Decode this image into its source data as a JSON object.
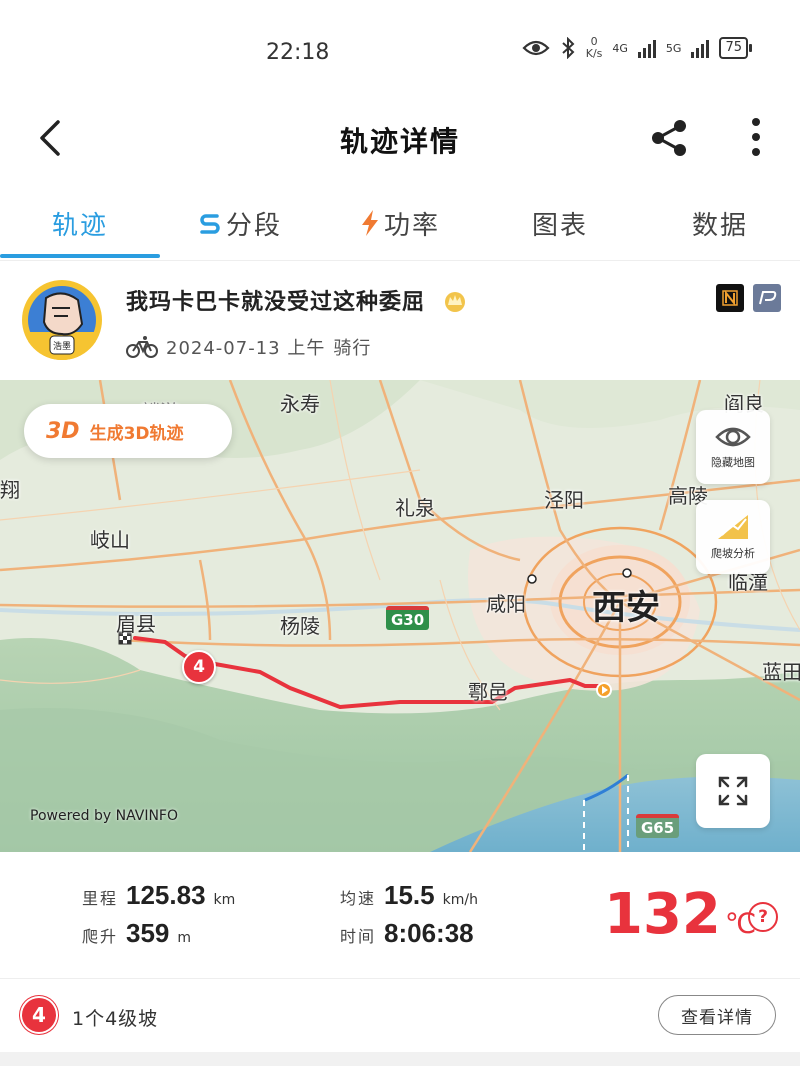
{
  "status": {
    "time": "22:18",
    "net_speed_value": "0",
    "net_speed_unit": "K/s",
    "sim1": "4G",
    "sim2": "5G",
    "battery": "75"
  },
  "header": {
    "title": "轨迹详情",
    "back_icon": "chevron-left-icon",
    "share_icon": "share-icon",
    "more_icon": "more-vertical-icon"
  },
  "tabs": [
    {
      "label": "轨迹",
      "active": true
    },
    {
      "label": "分段",
      "icon": "segment-icon"
    },
    {
      "label": "功率",
      "icon": "lightning-icon"
    },
    {
      "label": "图表"
    },
    {
      "label": "数据"
    }
  ],
  "profile": {
    "username": "我玛卡巴卡就没受过这种委屈",
    "date": "2024-07-13 上午",
    "activity": "骑行",
    "avatar_caption": "浩墨"
  },
  "map": {
    "btn_3d_tag": "3D",
    "btn_3d_label": "生成3D轨迹",
    "hide_map_label": "隐藏地图",
    "climb_analysis_label": "爬坡分析",
    "powered_by": "Powered by NAVINFO",
    "places": {
      "linyou": "麟游",
      "yongshou": "永寿",
      "yanliang": "阎良",
      "fengxiang": "翔",
      "liquan": "礼泉",
      "jingyang": "泾阳",
      "gaoling": "高陵",
      "qishan": "岐山",
      "meixian": "眉县",
      "yangling": "杨陵",
      "xianyang": "咸阳",
      "xian": "西安",
      "lintong": "临潼",
      "huyi": "鄠邑",
      "lantian": "蓝田"
    },
    "highways": {
      "g30": "G30",
      "g65": "G65"
    },
    "climb_marker": "4"
  },
  "stats": {
    "distance": {
      "label": "里程",
      "value": "125.83",
      "unit": "km"
    },
    "avg_speed": {
      "label": "均速",
      "value": "15.5",
      "unit": "km/h"
    },
    "elevation": {
      "label": "爬升",
      "value": "359",
      "unit": "m"
    },
    "duration": {
      "label": "时间",
      "value": "8:06:38"
    },
    "temperature": {
      "value": "132",
      "unit": "℃"
    },
    "help": "?"
  },
  "climbs": {
    "badge": "4",
    "text": "1个4级坡",
    "detail_button": "查看详情"
  },
  "colors": {
    "accent_blue": "#2a9de0",
    "route_red": "#e8333d",
    "orange": "#f07a32"
  }
}
